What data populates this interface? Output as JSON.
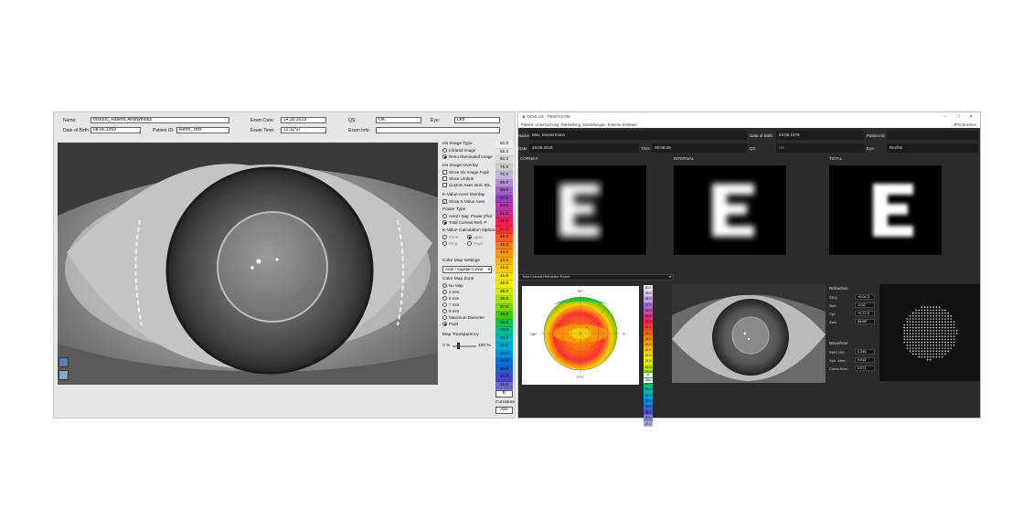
{
  "left": {
    "fields": {
      "name_label": "Name:",
      "name_value": "000005_Patient, Anonymous",
      "dob_label": "Date of Birth:",
      "dob_value": "08.06.1969",
      "patient_id_label": "Patient ID:",
      "patient_id_value": "Retro_Test",
      "exam_date_label": "Exam Date:",
      "exam_date_value": "14.30.2019",
      "exam_time_label": "Exam Time:",
      "exam_time_value": "12:11:07",
      "qs_label": "QS:",
      "qs_value": "OK",
      "eye_label": "Eye:",
      "eye_value": "Left",
      "exam_info_label": "Exam Info:",
      "exam_info_value": ""
    },
    "panel": {
      "iris_image_type": "Iris Image Type",
      "infrared": "Infrared Image",
      "retro": "Retro Illuminated Image",
      "iris_overlay": "Iris Image Overlay",
      "show_pupil": "Show Iris Image Pupil",
      "show_limbus": "Show Limbus",
      "custom_axes": "Custom Axes Ianic IOL",
      "kvalue_overlay": "K-Value Axes Overlay",
      "show_kvalue": "Show K-Value Axes",
      "power_type": "Power Type",
      "axial": "Axial / Sag. Power (Flor",
      "total_corneal": "Total Corneal Refr. P",
      "kvalue_calc": "K-Value Calculation Options",
      "zone": "Zone",
      "apex": "Apex",
      "ring": "Ring",
      "pupil_opt": "Pupil",
      "color_map_settings": "Color Map Settings",
      "color_map_select": "Axial / Sagittal Curvat",
      "color_map_zone": "Color Map Zone",
      "no_map": "No Map",
      "mm3": "3 mm",
      "mm5": "5 mm",
      "mm7": "7 mm",
      "mm9": "9 mm",
      "max_diameter": "Maximum Diameter",
      "pupil": "Pupil",
      "map_transparency": "Map Transparency",
      "pct0": "0 %",
      "pct100": "100 %",
      "transparency_value": 0.2
    },
    "scale_values": [
      "50.0",
      "55.0",
      "60.0",
      "75.0",
      "70.0",
      "65.0",
      "60.0",
      "57.0",
      "54.0",
      "51.0",
      "48.0",
      "47.0",
      "46.0",
      "45.0",
      "44.0",
      "43.0",
      "42.0",
      "41.0",
      "40.0",
      "39.0",
      "38.0",
      "37.0",
      "36.0",
      "35.0",
      "34.0",
      "33.0",
      "32.0",
      "31.0",
      "30.0",
      "25.0",
      "20.0",
      "15.0",
      "10.0"
    ],
    "scale_colors": [
      "#f2f2f2",
      "#e6e6e6",
      "#d9d9d9",
      "#cccccc",
      "#c7b3d9",
      "#b48ad3",
      "#a060c8",
      "#8b3fbf",
      "#c030a0",
      "#e0208a",
      "#ff1a5a",
      "#ff3030",
      "#ff5a20",
      "#ff7a10",
      "#ff9a00",
      "#ffb400",
      "#ffcc00",
      "#ffe000",
      "#f0ec00",
      "#d0ec00",
      "#a8e000",
      "#7cd400",
      "#40c800",
      "#10c050",
      "#00c090",
      "#00b8c0",
      "#00a8d8",
      "#0090e0",
      "#0070d8",
      "#2060d0",
      "#4848c8",
      "#6a6ad0",
      "#9090d8"
    ],
    "scale_bottom": "D",
    "curvature": "Curvature",
    "abs": "Abs"
  },
  "right": {
    "title": "OCULUS - PENTACAM",
    "menu": [
      "Patient",
      "Untersuchung",
      "Darstellung",
      "Einstellungen",
      "Externe Software"
    ],
    "menu_right": [
      "JPG",
      "Drucken"
    ],
    "patient": {
      "name_label": "Name",
      "name_value": "Max, Mustermann",
      "dob_label": "Date of Birth",
      "dob_value": "23.08.1979",
      "pid_label": "Patient ID",
      "pid_value": "",
      "date_label": "Date",
      "date_value": "23.08.2019",
      "time_label": "Time",
      "time_value": "08:58:39",
      "qs_label": "QS",
      "qs_value": "OK",
      "eye_label": "Eye",
      "eye_value": "Rechts"
    },
    "headers": [
      "CORNEA",
      "INTERNAL",
      "TOTAL"
    ],
    "map_select": "Total Corneal Refractive Power",
    "refraction_title": "Refraction",
    "refraction": [
      {
        "label": "SEQ:",
        "value": "+0.01 D"
      },
      {
        "label": "Sph:",
        "value": "-0.32"
      },
      {
        "label": "Cyl:",
        "value": "+0.72 D"
      },
      {
        "label": "Axis:",
        "value": "55.98°"
      }
    ],
    "wavefront_title": "Wavefront",
    "wavefront": [
      {
        "label": "RMS HO:",
        "value": "0.248"
      },
      {
        "label": "Sph. Aber.:",
        "value": "0.018"
      },
      {
        "label": "Coma Aber.:",
        "value": "0.071"
      }
    ],
    "scale_values": [
      "50.0",
      "49.0",
      "48.0",
      "47.0",
      "46.0",
      "45.5",
      "45.0",
      "44.5",
      "44.0",
      "43.5",
      "43.0",
      "42.5",
      "42.0",
      "41.5",
      "41.0",
      "40.5",
      "40.0",
      "39.0",
      "38.0",
      "37.0",
      "36.0",
      "35.0",
      "34.0",
      "30.0",
      "24.0"
    ],
    "scale_colors": [
      "#e8e8e8",
      "#d8c8e8",
      "#c0a0e0",
      "#a070d0",
      "#c050b0",
      "#e03080",
      "#ff2050",
      "#ff4030",
      "#ff6a10",
      "#ff8c00",
      "#ffaa00",
      "#ffc800",
      "#ffe000",
      "#e8f000",
      "#b8e800",
      "#80d800",
      "#40c800",
      "#10c060",
      "#00b8a8",
      "#00a8d0",
      "#0090e0",
      "#2070d8",
      "#5050c8",
      "#8080d0",
      "#b0b0e0"
    ],
    "scale_bottom": "D",
    "scale_unit": "Abs",
    "polar_top": "90°",
    "polar_bottom": "270°",
    "polar_left": "180°",
    "polar_right": "0°"
  }
}
